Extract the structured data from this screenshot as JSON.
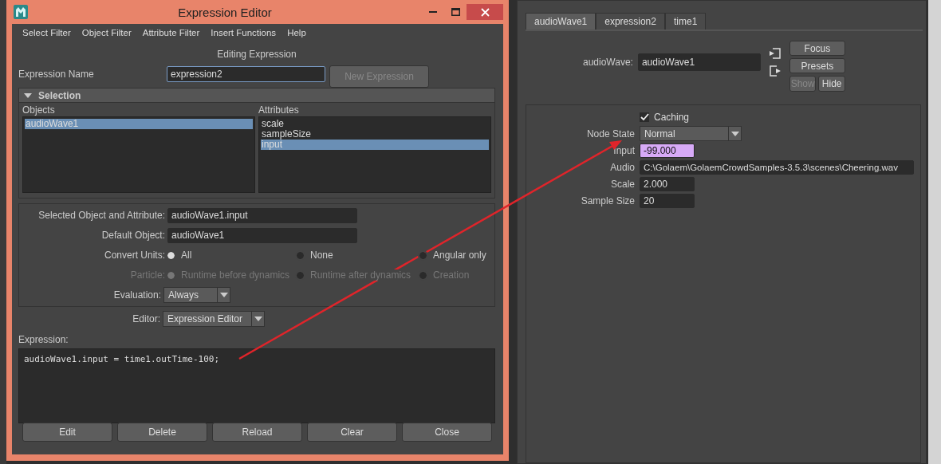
{
  "window": {
    "title": "Expression Editor"
  },
  "menu": [
    "Select Filter",
    "Object Filter",
    "Attribute Filter",
    "Insert Functions",
    "Help"
  ],
  "editing_label": "Editing Expression",
  "expression_name": {
    "label": "Expression Name",
    "value": "expression2"
  },
  "new_expression_button": {
    "label": "New Expression",
    "disabled": true
  },
  "selection": {
    "title": "Selection",
    "expanded": true,
    "objects": {
      "heading": "Objects",
      "items": [
        {
          "label": "audioWave1",
          "selected": true
        }
      ]
    },
    "attributes": {
      "heading": "Attributes",
      "items": [
        {
          "label": "scale",
          "selected": false
        },
        {
          "label": "sampleSize",
          "selected": false
        },
        {
          "label": "input",
          "selected": true
        }
      ]
    }
  },
  "fields": [
    {
      "label": "Selected Object and Attribute:",
      "value": "audioWave1.input"
    },
    {
      "label": "Default Object:",
      "value": "audioWave1"
    }
  ],
  "radio_rows": [
    {
      "label": "Convert Units:",
      "disabled": false,
      "options": [
        {
          "label": "All",
          "selected": true
        },
        {
          "label": "None",
          "selected": false
        },
        {
          "label": "Angular only",
          "selected": false
        }
      ]
    },
    {
      "label": "Particle:",
      "disabled": true,
      "options": [
        {
          "label": "Runtime before dynamics",
          "selected": true
        },
        {
          "label": "Runtime after dynamics",
          "selected": false
        },
        {
          "label": "Creation",
          "selected": false
        }
      ]
    }
  ],
  "evaluation": {
    "label": "Evaluation:",
    "value": "Always"
  },
  "editor": {
    "label": "Editor:",
    "value": "Expression Editor"
  },
  "expression": {
    "label": "Expression:",
    "code": "audioWave1.input = time1.outTime-100;"
  },
  "buttons": [
    "Edit",
    "Delete",
    "Reload",
    "Clear",
    "Close"
  ],
  "attribute_editor": {
    "tabs": [
      {
        "label": "audioWave1",
        "selected": true
      },
      {
        "label": "expression2",
        "selected": false
      },
      {
        "label": "time1",
        "selected": false
      }
    ],
    "node_label": "audioWave:",
    "node_name": "audioWave1",
    "buttons": [
      {
        "label": "Focus",
        "disabled": false
      },
      {
        "label": "Presets",
        "disabled": false
      },
      {
        "label": "Show",
        "disabled": true
      },
      {
        "label": "Hide",
        "disabled": false
      }
    ],
    "caching": {
      "label": "Caching",
      "checked": true
    },
    "attributes": [
      {
        "kind": "dropdown",
        "label": "Node State",
        "value": "Normal"
      },
      {
        "kind": "field",
        "label": "Input",
        "value": "-99.000",
        "driven": true
      },
      {
        "kind": "path",
        "label": "Audio",
        "value": "C:\\Golaem\\GolaemCrowdSamples-3.5.3\\scenes\\Cheering.wav",
        "driven": false
      },
      {
        "kind": "field",
        "label": "Scale",
        "value": "2.000",
        "driven": false
      },
      {
        "kind": "field",
        "label": "Sample Size",
        "value": "20",
        "driven": false
      }
    ]
  }
}
